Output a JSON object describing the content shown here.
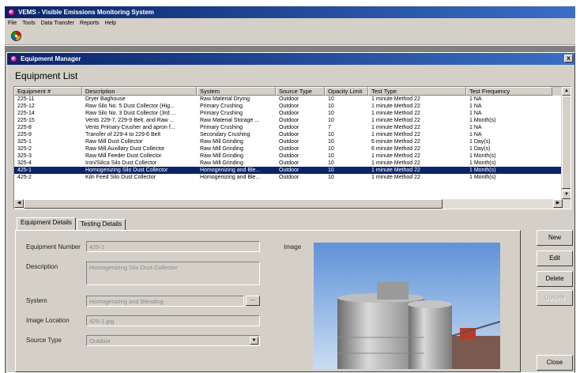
{
  "app": {
    "title": "VEMS - Visible Emissions Monitoring System"
  },
  "menu": [
    "File",
    "Tools",
    "Data Transfer",
    "Reports",
    "Help"
  ],
  "child_window": {
    "title": "Equipment Manager",
    "close": "x"
  },
  "equipment_list": {
    "heading": "Equipment List",
    "columns": [
      "Equipment #",
      "Description",
      "System",
      "Source Type",
      "Opacity Limit",
      "Test Type",
      "Test Frequency"
    ],
    "rows": [
      [
        "225-11",
        "Dryer Baghouse",
        "Raw Material Drying",
        "Outdoor",
        "10",
        "1 minute Method 22",
        "1 NA"
      ],
      [
        "225-12",
        "Raw Silo No. 5 Dust Collector (Hig...",
        "Primary Crushing",
        "Outdoor",
        "10",
        "1 minute Method 22",
        "1 NA"
      ],
      [
        "225-14",
        "Raw Silo No. 3 Dust Collector (3rd ...",
        "Primary Crushing",
        "Outdoor",
        "10",
        "1 minute Method 22",
        "1 NA"
      ],
      [
        "225-15",
        "Vents 229-7, 229-9 Belt, and Raw ...",
        "Raw Material Storage ...",
        "Outdoor",
        "10",
        "1 minute Method 22",
        "1 Month(s)"
      ],
      [
        "225-8",
        "Vents Primary Crusher and apron f...",
        "Primary Crushing",
        "Outdoor",
        "7",
        "1 minute Method 22",
        "1 NA"
      ],
      [
        "225-9",
        "Transfer of 229-4 to 229-6 Belt",
        "Secondary Crushing",
        "Outdoor",
        "10",
        "1 minute Method 22",
        "1 NA"
      ],
      [
        "325-1",
        "Raw Mill Dust Collector",
        "Raw Mill Grinding",
        "Outdoor",
        "10",
        "6 minute Method 22",
        "1 Day(s)"
      ],
      [
        "325-2",
        "Raw Mill Auxillary Dust Collector",
        "Raw Mill Grinding",
        "Outdoor",
        "10",
        "6 minute Method 22",
        "1 Day(s)"
      ],
      [
        "325-3",
        "Raw Mill Feeder Dust Collector",
        "Raw Mill Grinding",
        "Outdoor",
        "10",
        "1 minute Method 22",
        "1 Month(s)"
      ],
      [
        "325-4",
        "Iron/Silica Silo Dust Collector",
        "Raw Mill Grinding",
        "Outdoor",
        "10",
        "1 minute Method 22",
        "1 Month(s)"
      ],
      [
        "425-1",
        "Homogenizing Silo Dust Collector",
        "Homogenizing and Ble...",
        "Outdoor",
        "10",
        "1 minute Method 22",
        "1 Month(s)"
      ],
      [
        "425-2",
        "Kiln Feed Silo Dust Collector",
        "Homogenizing and Ble...",
        "Outdoor",
        "10",
        "1 minute Method 22",
        "1 Month(s)"
      ]
    ],
    "selected_row": 10
  },
  "tabs": [
    "Equipment Details",
    "Testing Details"
  ],
  "details": {
    "equipment_number_label": "Equipment Number",
    "equipment_number": "425-1",
    "description_label": "Description",
    "description": "Homogenizing Silo Dust Collector",
    "system_label": "System",
    "system": "Homogenizing and Blending",
    "system_browse": "...",
    "image_location_label": "Image Location",
    "image_location": "425-1.jpg",
    "source_type_label": "Source Type",
    "source_type": "Outdoor",
    "image_label": "Image"
  },
  "buttons": {
    "new": "New",
    "edit": "Edit",
    "delete": "Delete",
    "update": "Update",
    "close": "Close"
  },
  "colors": {
    "titlebar": "#0a246a",
    "selection": "#0a246a",
    "face": "#d4d0c8",
    "workspace": "#808080"
  }
}
